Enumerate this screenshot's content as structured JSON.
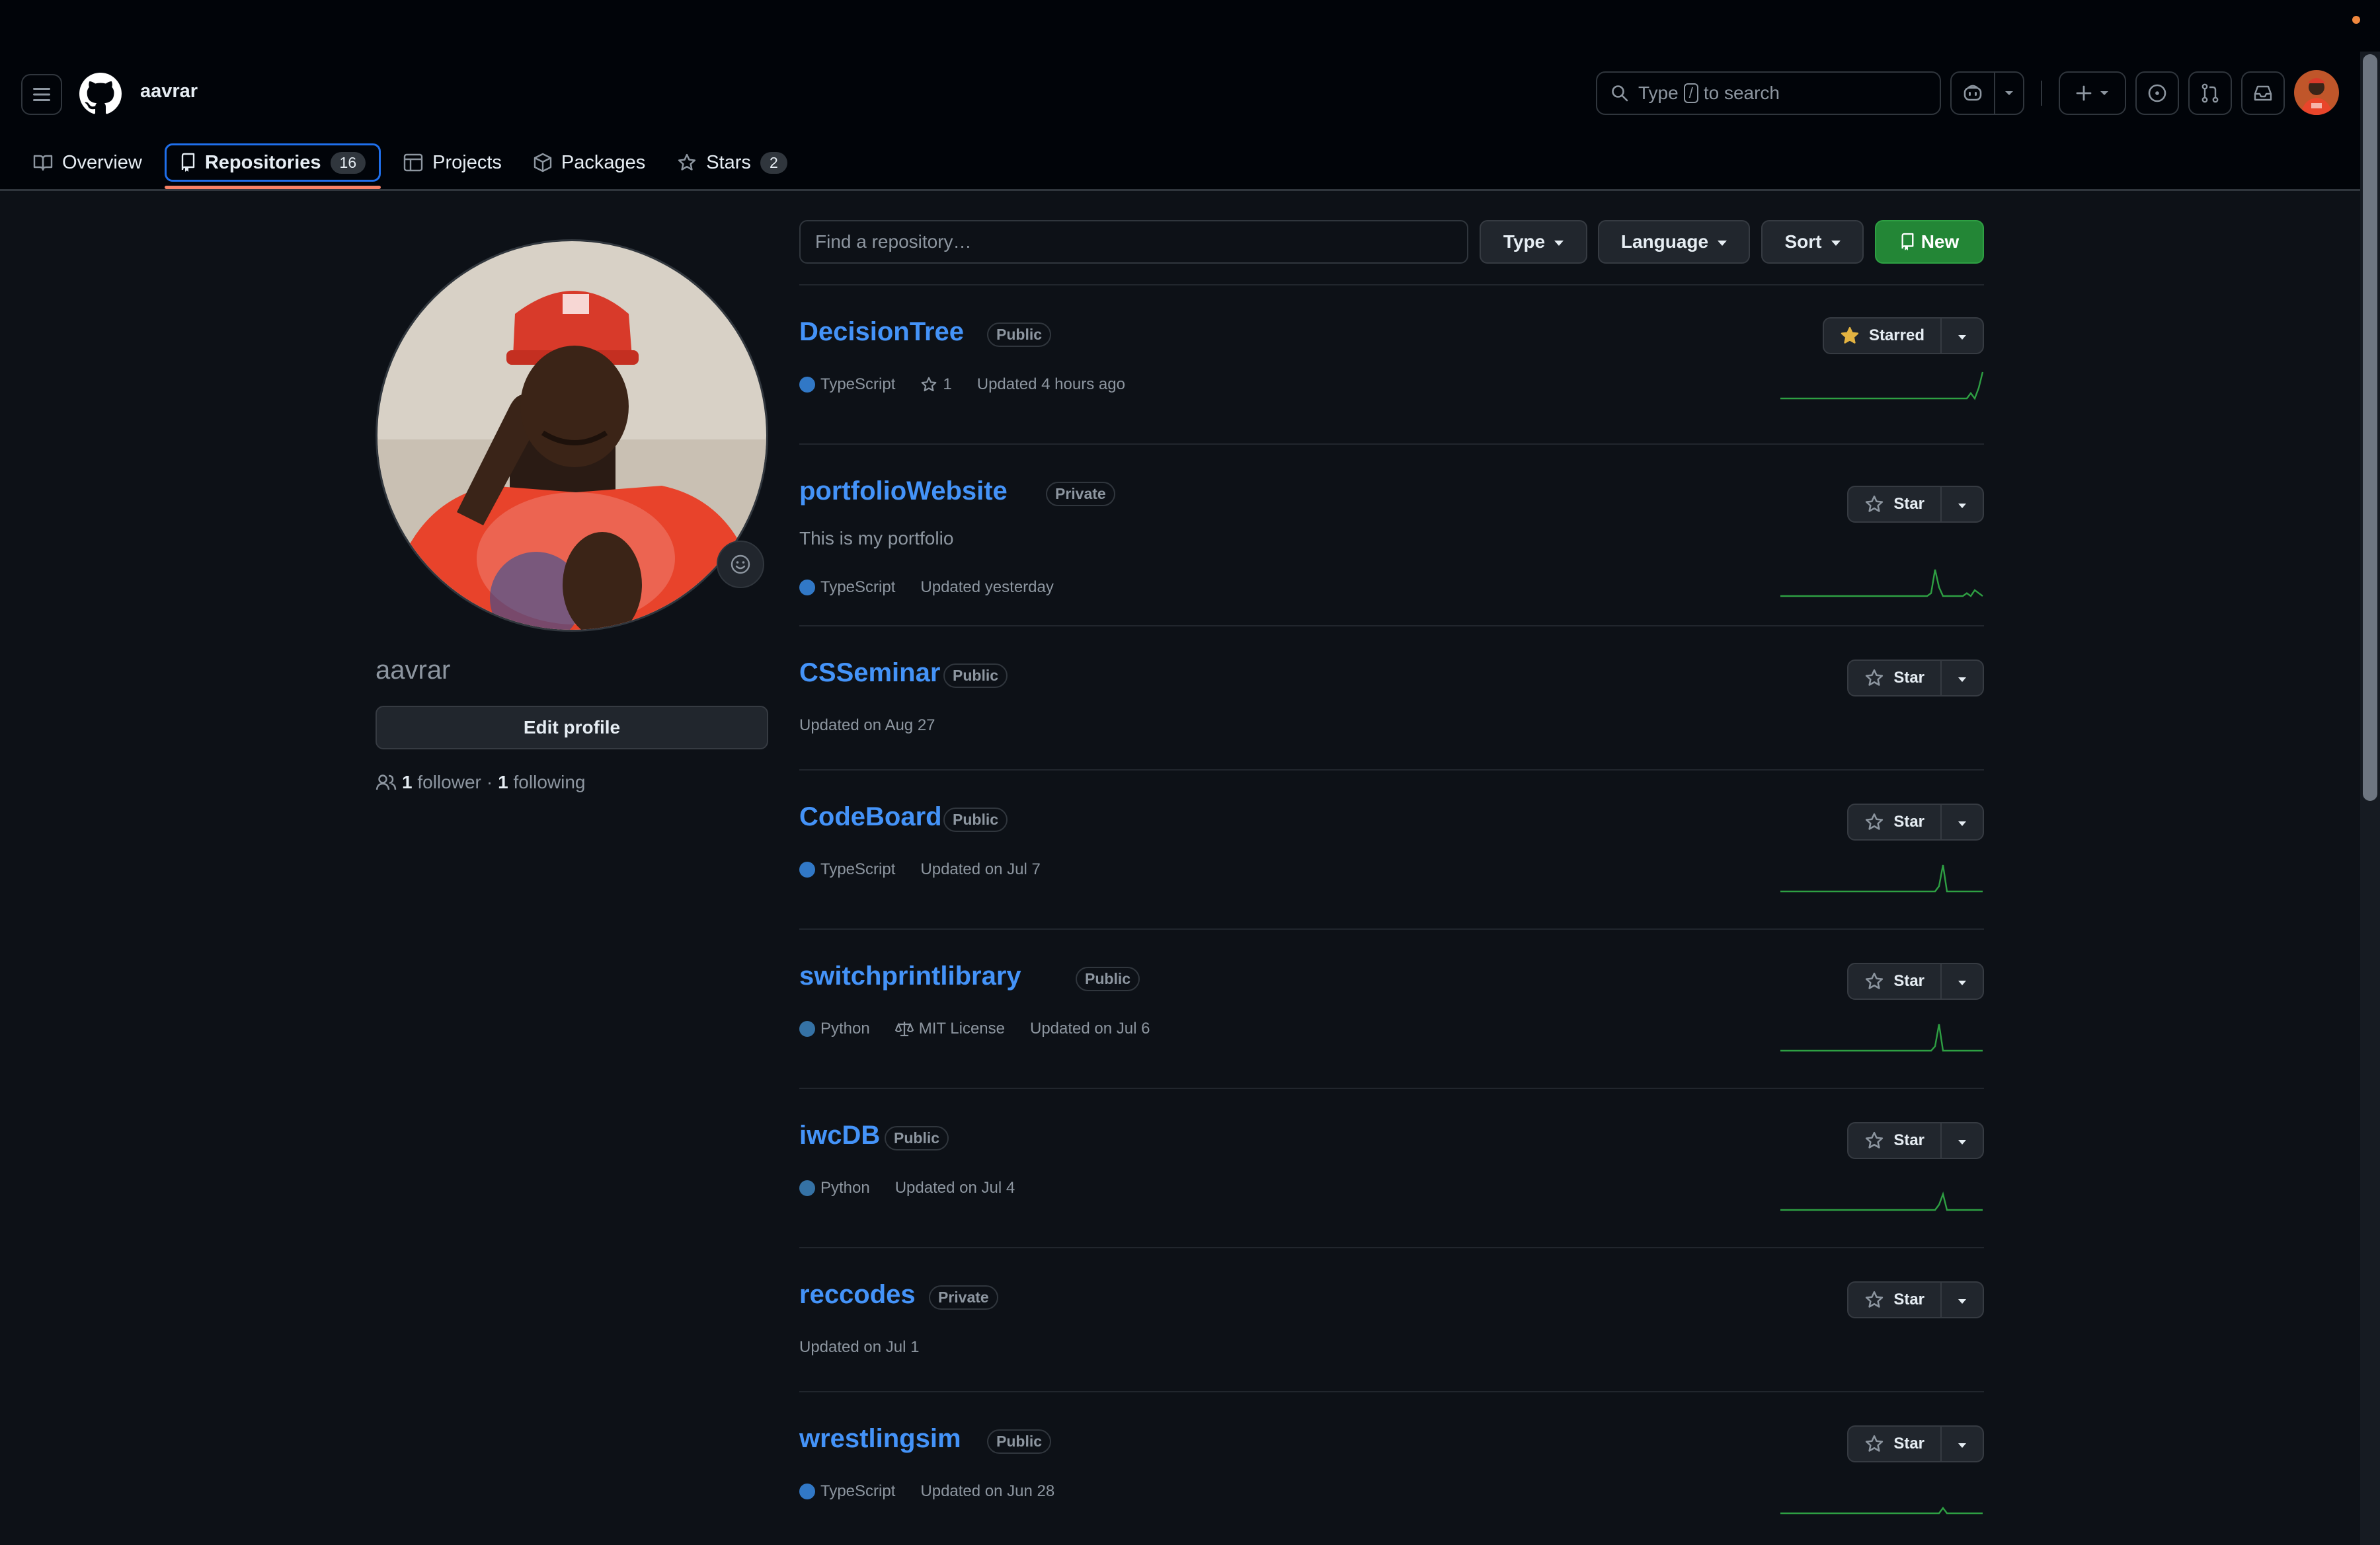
{
  "header": {
    "owner": "aavrar",
    "search": {
      "prefix": "Type",
      "key": "/",
      "suffix": "to search"
    }
  },
  "tabs": [
    {
      "label": "Overview",
      "icon": "book-icon"
    },
    {
      "label": "Repositories",
      "icon": "repo-icon",
      "count": "16",
      "selected": true
    },
    {
      "label": "Projects",
      "icon": "table-icon"
    },
    {
      "label": "Packages",
      "icon": "package-icon"
    },
    {
      "label": "Stars",
      "icon": "star-icon",
      "count": "2"
    }
  ],
  "profile": {
    "username": "aavrar",
    "edit_label": "Edit profile",
    "followers": "1",
    "followers_label": "follower",
    "separator": "·",
    "following": "1",
    "following_label": "following"
  },
  "filters": {
    "find_placeholder": "Find a repository…",
    "type_label": "Type",
    "language_label": "Language",
    "sort_label": "Sort",
    "new_label": "New"
  },
  "repos": [
    {
      "name": "DecisionTree",
      "visibility": "Public",
      "description": "",
      "language": "TypeScript",
      "stars": "1",
      "license": "",
      "updated": "Updated 4 hours ago",
      "star_label": "Starred",
      "starred": true,
      "activity": [
        0,
        0,
        0,
        0,
        0,
        0,
        0,
        0,
        0,
        0,
        0,
        0,
        0,
        0,
        0,
        0,
        0,
        0,
        0,
        0,
        0,
        0,
        0,
        0,
        0,
        0,
        0,
        0,
        0,
        0,
        0,
        0,
        0,
        0,
        0,
        0,
        0,
        0,
        0,
        0,
        0,
        0,
        0,
        0,
        0,
        0,
        0,
        0,
        1,
        0,
        2,
        5
      ]
    },
    {
      "name": "portfolioWebsite",
      "visibility": "Private",
      "description": "This is my portfolio",
      "language": "TypeScript",
      "stars": "",
      "license": "",
      "updated": "Updated yesterday",
      "star_label": "Star",
      "starred": false,
      "activity": [
        0,
        0,
        0,
        0,
        0,
        0,
        0,
        0,
        0,
        0,
        0,
        0,
        0,
        0,
        0,
        0,
        0,
        0,
        0,
        0,
        0,
        0,
        0,
        0,
        0,
        0,
        0,
        0,
        0,
        0,
        0,
        0,
        0,
        0,
        0,
        0,
        0,
        0,
        1,
        9,
        3,
        0,
        0,
        0,
        0,
        0,
        0,
        1,
        0,
        2,
        1,
        0
      ]
    },
    {
      "name": "CSSeminar",
      "visibility": "Public",
      "description": "",
      "language": "",
      "stars": "",
      "license": "",
      "updated": "Updated on Aug 27",
      "star_label": "Star",
      "starred": false,
      "activity": []
    },
    {
      "name": "CodeBoard",
      "visibility": "Public",
      "description": "",
      "language": "TypeScript",
      "stars": "",
      "license": "",
      "updated": "Updated on Jul 7",
      "star_label": "Star",
      "starred": false,
      "activity": [
        0,
        0,
        0,
        0,
        0,
        0,
        0,
        0,
        0,
        0,
        0,
        0,
        0,
        0,
        0,
        0,
        0,
        0,
        0,
        0,
        0,
        0,
        0,
        0,
        0,
        0,
        0,
        0,
        0,
        0,
        0,
        0,
        0,
        0,
        0,
        0,
        0,
        0,
        0,
        0,
        1,
        5,
        0,
        0,
        0,
        0,
        0,
        0,
        0,
        0,
        0,
        0
      ]
    },
    {
      "name": "switchprintlibrary",
      "visibility": "Public",
      "description": "",
      "language": "Python",
      "stars": "",
      "license": "MIT License",
      "updated": "Updated on Jul 6",
      "star_label": "Star",
      "starred": false,
      "activity": [
        0,
        0,
        0,
        0,
        0,
        0,
        0,
        0,
        0,
        0,
        0,
        0,
        0,
        0,
        0,
        0,
        0,
        0,
        0,
        0,
        0,
        0,
        0,
        0,
        0,
        0,
        0,
        0,
        0,
        0,
        0,
        0,
        0,
        0,
        0,
        0,
        0,
        0,
        0,
        1,
        6,
        0,
        0,
        0,
        0,
        0,
        0,
        0,
        0,
        0,
        0,
        0
      ]
    },
    {
      "name": "iwcDB",
      "visibility": "Public",
      "description": "",
      "language": "Python",
      "stars": "",
      "license": "",
      "updated": "Updated on Jul 4",
      "star_label": "Star",
      "starred": false,
      "activity": [
        0,
        0,
        0,
        0,
        0,
        0,
        0,
        0,
        0,
        0,
        0,
        0,
        0,
        0,
        0,
        0,
        0,
        0,
        0,
        0,
        0,
        0,
        0,
        0,
        0,
        0,
        0,
        0,
        0,
        0,
        0,
        0,
        0,
        0,
        0,
        0,
        0,
        0,
        0,
        0,
        1,
        3,
        0,
        0,
        0,
        0,
        0,
        0,
        0,
        0,
        0,
        0
      ]
    },
    {
      "name": "reccodes",
      "visibility": "Private",
      "description": "",
      "language": "",
      "stars": "",
      "license": "",
      "updated": "Updated on Jul 1",
      "star_label": "Star",
      "starred": false,
      "activity": []
    },
    {
      "name": "wrestlingsim",
      "visibility": "Public",
      "description": "",
      "language": "TypeScript",
      "stars": "",
      "license": "",
      "updated": "Updated on Jun 28",
      "star_label": "Star",
      "starred": false,
      "activity": [
        0,
        0,
        0,
        0,
        0,
        0,
        0,
        0,
        0,
        0,
        0,
        0,
        0,
        0,
        0,
        0,
        0,
        0,
        0,
        0,
        0,
        0,
        0,
        0,
        0,
        0,
        0,
        0,
        0,
        0,
        0,
        0,
        0,
        0,
        0,
        0,
        0,
        0,
        0,
        0,
        0,
        1,
        0,
        0,
        0,
        0,
        0,
        0,
        0,
        0,
        0,
        0
      ]
    }
  ],
  "colors": {
    "background": "#0d1117",
    "header": "#010409",
    "link": "#4493f8",
    "accent_border": "#1f6feb",
    "tab_underline": "#f78166",
    "new_button": "#238636",
    "typescript": "#3178c6",
    "python": "#3572A5",
    "sparkline": "#2ea043",
    "starred": "#e3b341"
  }
}
